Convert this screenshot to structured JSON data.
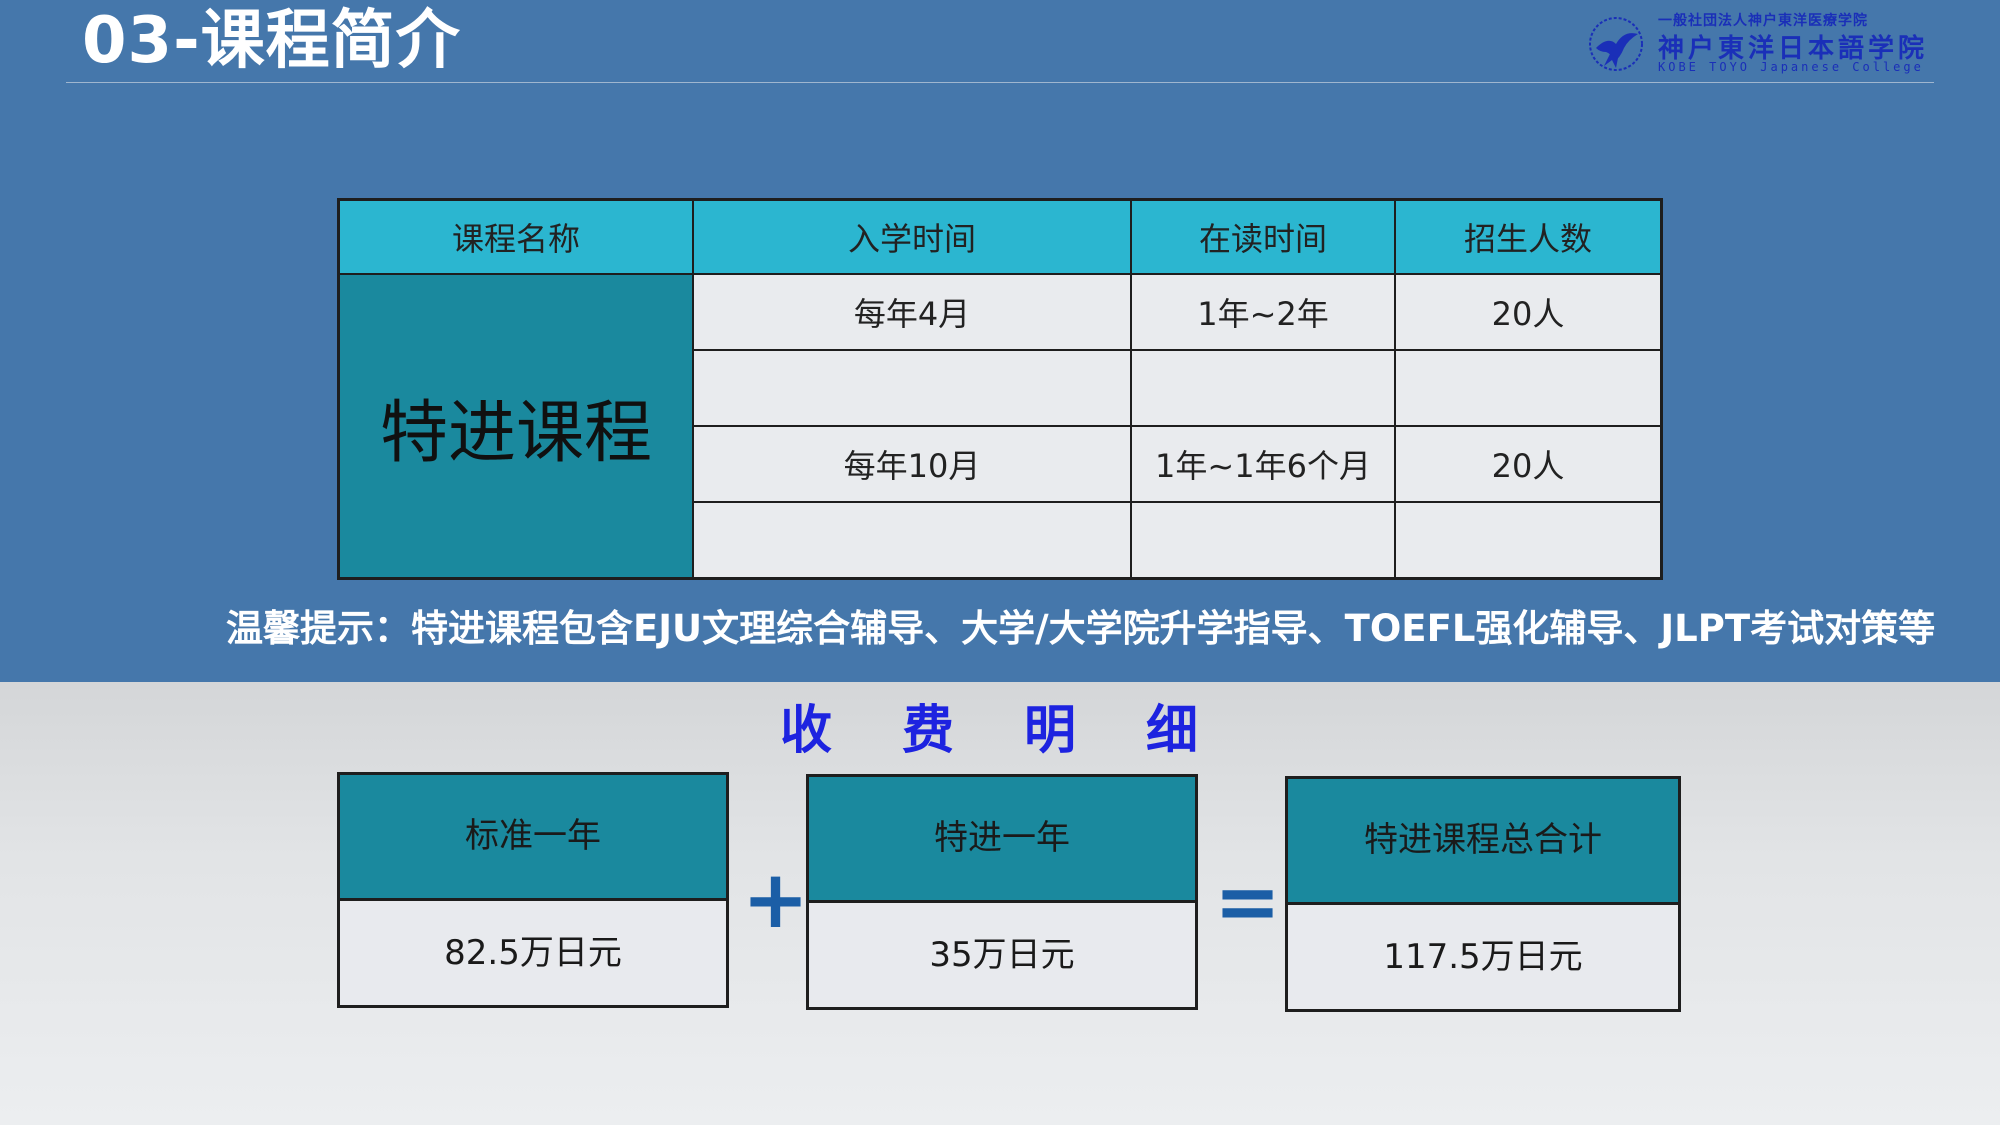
{
  "header": {
    "title": "03-课程简介",
    "logo": {
      "line1": "一般社団法人神户東洋医療学院",
      "line2": "神户東洋日本語学院",
      "line3": "KOBE TOYO Japanese College",
      "emblem": "eagle-emblem-icon"
    }
  },
  "course_table": {
    "headers": [
      "课程名称",
      "入学时间",
      "在读时间",
      "招生人数"
    ],
    "course_name": "特进课程",
    "rows": [
      {
        "intake": "每年4月",
        "duration": "1年~2年",
        "quota": "20人"
      },
      {
        "intake": "",
        "duration": "",
        "quota": ""
      },
      {
        "intake": "每年10月",
        "duration": "1年~1年6个月",
        "quota": "20人"
      },
      {
        "intake": "",
        "duration": "",
        "quota": ""
      }
    ]
  },
  "tip": "温馨提示：特进课程包含EJU文理综合辅导、大学/大学院升学指导、TOEFL强化辅导、JLPT考试对策等",
  "fees": {
    "title": "收费明细",
    "items": [
      {
        "label": "标准一年",
        "value": "82.5万日元"
      },
      {
        "label": "特进一年",
        "value": "35万日元"
      },
      {
        "label": "特进课程总合计",
        "value": "117.5万日元"
      }
    ],
    "operators": [
      "+",
      "="
    ]
  },
  "colors": {
    "top_band": "#4577ab",
    "table_header": "#2bb6d0",
    "teal": "#1a899e",
    "fee_title": "#1d23e0",
    "operator": "#1b5ea6"
  }
}
